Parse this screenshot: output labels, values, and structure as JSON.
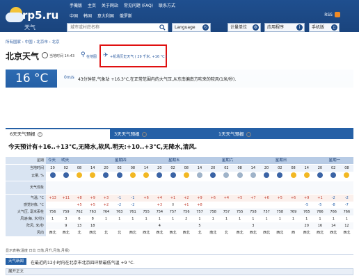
{
  "site": {
    "name": "rp5.ru",
    "subtitle": "天气"
  },
  "header": {
    "links_row1": [
      "手機版",
      "主页",
      "关于网站",
      "常见问题 (FAQ)",
      "联系方式"
    ],
    "links_row2": [
      "中国",
      "韩国",
      "意大利国",
      "俄罗斯"
    ],
    "rss": "RSS",
    "search_placeholder": "城市或村莊名称",
    "language_label": "Language",
    "units_label": "计量单位",
    "apps_label": "应用程序",
    "mobile_label": "手机版"
  },
  "breadcrumb": "所有国家 › 中国 › 北京市 › 北京",
  "page": {
    "title": "北京天气",
    "local_time": "当地时间 14:43",
    "map_link": "在地图",
    "airport_link": "+机场历史天气 ( 29 千米, +16 °C )"
  },
  "current": {
    "temp": "16 °C",
    "wind_label": "0m/s",
    "text": "43分钟前,气象站 +16.3°C,在正常范围内的大气压,从东南偏南方吹来的软风(1米/秒)."
  },
  "tabs": [
    {
      "label": "6天天气预报",
      "active": true
    },
    {
      "label": "3天天气预报",
      "active": false
    },
    {
      "label": "1天天气预报",
      "active": false
    }
  ],
  "summary": "今天预计有+16..+13°C,无降水,软风.明天:+10..+3°C,无降水,清风.",
  "grid": {
    "days": [
      "今天",
      "明天",
      "星期四",
      "星期五",
      "星期六",
      "星期日",
      "星期一"
    ],
    "row_labels": [
      "星期",
      "当地时间",
      "云量, %",
      "天气现象",
      "气温, °C",
      "感觉好像, °C",
      "大气压, 毫米汞柱",
      "风速(每, 米/秒)",
      "阵风, 米/秒",
      "风向"
    ],
    "times": [
      "20",
      "02",
      "08",
      "14",
      "20",
      "02",
      "08",
      "14",
      "20",
      "02",
      "08",
      "14",
      "20",
      "02",
      "08",
      "14",
      "20",
      "02",
      "08",
      "14",
      "20",
      "02",
      "08"
    ],
    "cloud": [
      "moon",
      "moon",
      "sun",
      "sun",
      "moon",
      "moon",
      "sun",
      "sun",
      "moon",
      "moon",
      "sun",
      "cloud",
      "moon",
      "cloud",
      "cloud",
      "cloud",
      "moon",
      "moon",
      "sun",
      "sun",
      "moon",
      "moon",
      "sun"
    ],
    "temp": [
      "+13",
      "+11",
      "+8",
      "+9",
      "+3",
      "-1",
      "-1",
      "+6",
      "+4",
      "+1",
      "+2",
      "+9",
      "+6",
      "+4",
      "+5",
      "+7",
      "+6",
      "+5",
      "+6",
      "+9",
      "+1",
      "-2",
      "-2"
    ],
    "feels": [
      "",
      "",
      "+5",
      "+5",
      "+2",
      "-2",
      "-2",
      "",
      "+3",
      "0",
      "+1",
      "+8",
      "",
      "",
      "",
      "",
      "",
      "",
      "",
      "-5",
      "-5",
      "-8",
      "-7"
    ],
    "pressure": [
      "756",
      "759",
      "762",
      "763",
      "764",
      "763",
      "761",
      "755",
      "754",
      "757",
      "756",
      "757",
      "758",
      "757",
      "755",
      "758",
      "757",
      "758",
      "769",
      "765",
      "766",
      "766",
      "766"
    ],
    "wind": [
      "1",
      "3",
      "6",
      "8",
      "1",
      "1",
      "1",
      "1",
      "1",
      "1",
      "2",
      "1",
      "1",
      "1",
      "1",
      "1",
      "1",
      "1",
      "1",
      "1",
      "1",
      "1",
      "1"
    ],
    "gust": [
      "",
      "9",
      "13",
      "18",
      "",
      "",
      "",
      "",
      "4",
      "",
      "",
      "5",
      "",
      "",
      "",
      "3",
      "",
      "",
      "",
      "20",
      "16",
      "14",
      "12"
    ],
    "dir": [
      "西北",
      "西北",
      "北",
      "西北",
      "北",
      "北",
      "西北",
      "西北",
      "西北",
      "西北",
      "西北",
      "北",
      "南北",
      "北",
      "西北",
      "西北",
      "西北",
      "西北",
      "西",
      "西北",
      "西北",
      "西北",
      "西北"
    ]
  },
  "grid_legend": "显示表格(温度 日出 日落,月升,月落,月相)",
  "footer": {
    "label": "天气新闻",
    "text": "在最近的12小时内在北京市北京四环新最低气温 +9 °C.",
    "expand": "展开正文"
  }
}
